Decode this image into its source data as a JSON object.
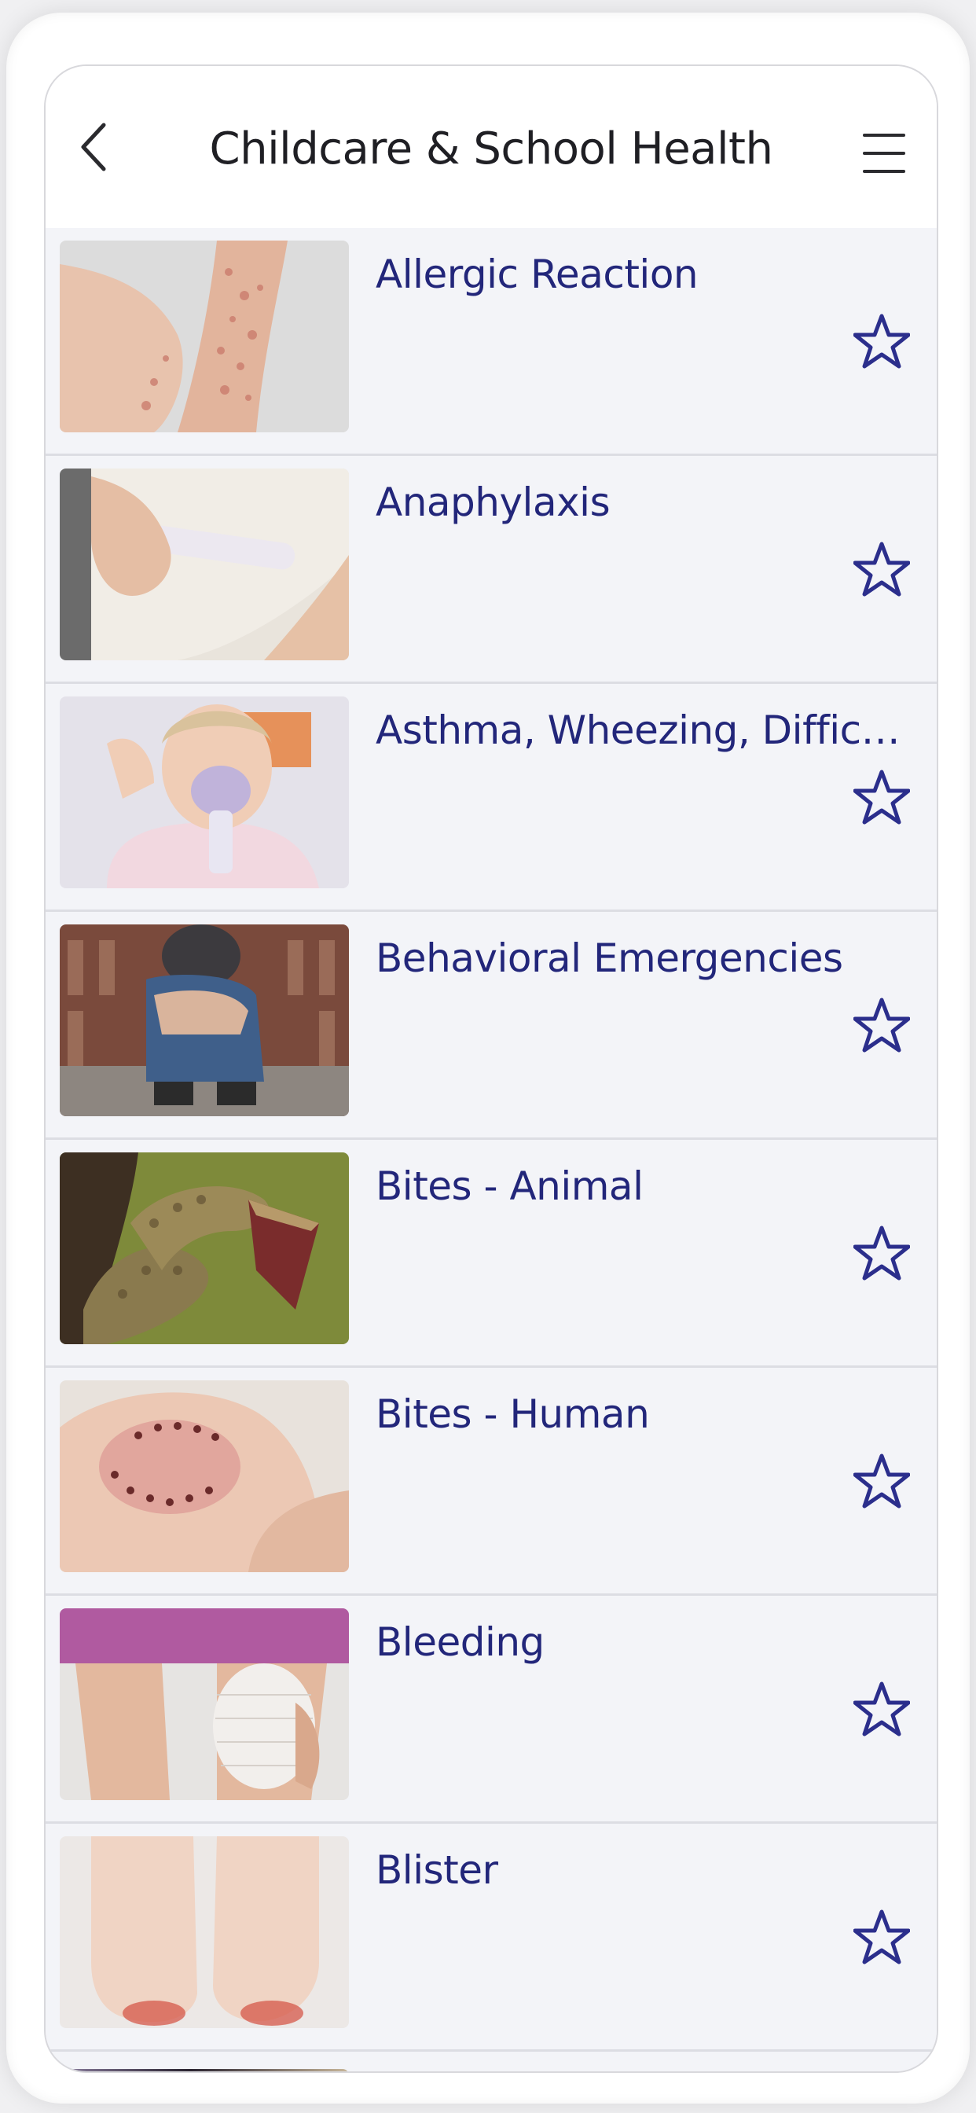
{
  "header": {
    "title": "Childcare & School Health",
    "back_icon": "chevron-left-icon",
    "menu_icon": "hamburger-menu-icon"
  },
  "colors": {
    "title_text": "#1f1f24",
    "item_text": "#22267a",
    "star_outline": "#2b2e8c",
    "list_background": "#f3f4f8"
  },
  "items": [
    {
      "title": "Allergic Reaction",
      "image": "rash-on-arm",
      "favorite": false
    },
    {
      "title": "Anaphylaxis",
      "image": "epinephrine-auto-injector",
      "favorite": false
    },
    {
      "title": "Asthma, Wheezing, Difficult …",
      "image": "child-with-nebulizer-mask",
      "favorite": false
    },
    {
      "title": "Behavioral Emergencies",
      "image": "child-hugging-knees",
      "favorite": false
    },
    {
      "title": "Bites - Animal",
      "image": "snake-with-open-mouth",
      "favorite": false
    },
    {
      "title": "Bites - Human",
      "image": "bite-mark-on-hand",
      "favorite": false
    },
    {
      "title": "Bleeding",
      "image": "bandaged-knee",
      "favorite": false
    },
    {
      "title": "Blister",
      "image": "heels-with-blisters",
      "favorite": false
    }
  ]
}
